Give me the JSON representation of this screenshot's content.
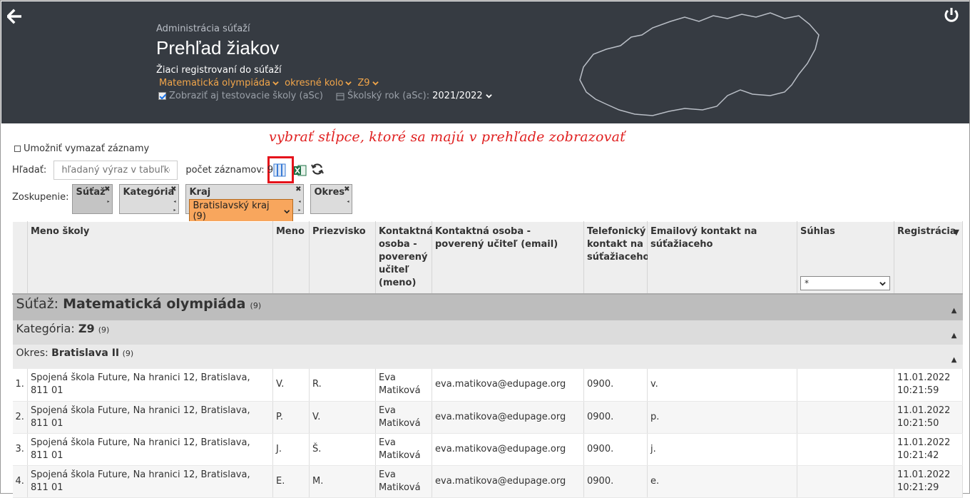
{
  "header": {
    "admin_subtitle": "Administrácia súťaží",
    "title": "Prehľad žiakov",
    "description": "Žiaci registrovaní do súťaží",
    "filters": [
      {
        "label": "Matematická olympiáda"
      },
      {
        "label": "okresné kolo"
      },
      {
        "label": "Z9"
      }
    ],
    "show_test_schools": "Zobraziť aj testovacie školy (aSc)",
    "school_year_label": "Školský rok (aSc):",
    "school_year_value": "2021/2022"
  },
  "annotation": "vybrať stĺpce, ktoré sa majú v prehľade zobrazovať",
  "allow_delete": "Umožniť vymazať záznamy",
  "search": {
    "label": "Hľadať:",
    "placeholder": "hľadaný výraz v tabuľke",
    "count_label": "počet záznamov: 9"
  },
  "grouping": {
    "label": "Zoskupenie:",
    "items": [
      {
        "label": "Súťaž"
      },
      {
        "label": "Kategória"
      },
      {
        "label": "Kraj",
        "selected": "Bratislavský kraj (9)"
      },
      {
        "label": "Okres"
      }
    ]
  },
  "table": {
    "columns": [
      "",
      "Meno školy",
      "Meno",
      "Priezvisko",
      "Kontaktná osoba - poverený učiteľ (meno)",
      "Kontaktná osoba - poverený učiteľ (email)",
      "Telefonický kontakt na súťažiaceho",
      "Emailový kontakt na súťažiaceho",
      "Súhlas",
      "Registrácia"
    ],
    "suhlas_filter": "*",
    "group1": {
      "prefix": "Súťaž:",
      "name": "Matematická olympiáda",
      "count": "(9)"
    },
    "group2": {
      "prefix": "Kategória:",
      "name": "Z9",
      "count": "(9)"
    },
    "group3": {
      "prefix": "Okres:",
      "name": "Bratislava II",
      "count": "(9)"
    },
    "rows": [
      {
        "n": "1.",
        "school": "Spojená škola Future, Na hranici 12, Bratislava, 811 01",
        "first": "V.",
        "last": "R.",
        "contact": "Eva Matiková",
        "email": "eva.matikova@edupage.org",
        "phone": "0900.",
        "semail": "v.",
        "consent": "",
        "reg_date": "11.01.2022",
        "reg_time": "10:21:59"
      },
      {
        "n": "2.",
        "school": "Spojená škola Future, Na hranici 12, Bratislava, 811 01",
        "first": "P.",
        "last": "V.",
        "contact": "Eva Matiková",
        "email": "eva.matikova@edupage.org",
        "phone": "0900.",
        "semail": "p.",
        "consent": "",
        "reg_date": "11.01.2022",
        "reg_time": "10:21:50"
      },
      {
        "n": "3.",
        "school": "Spojená škola Future, Na hranici 12, Bratislava, 811 01",
        "first": "J.",
        "last": "Š.",
        "contact": "Eva Matiková",
        "email": "eva.matikova@edupage.org",
        "phone": "0900.",
        "semail": "j.",
        "consent": "",
        "reg_date": "11.01.2022",
        "reg_time": "10:21:42"
      },
      {
        "n": "4.",
        "school": "Spojená škola Future, Na hranici 12, Bratislava, 811 01",
        "first": "E.",
        "last": "M.",
        "contact": "Eva Matiková",
        "email": "eva.matikova@edupage.org",
        "phone": "0900.",
        "semail": "e.",
        "consent": "",
        "reg_date": "11.01.2022",
        "reg_time": "10:21:29"
      }
    ]
  }
}
